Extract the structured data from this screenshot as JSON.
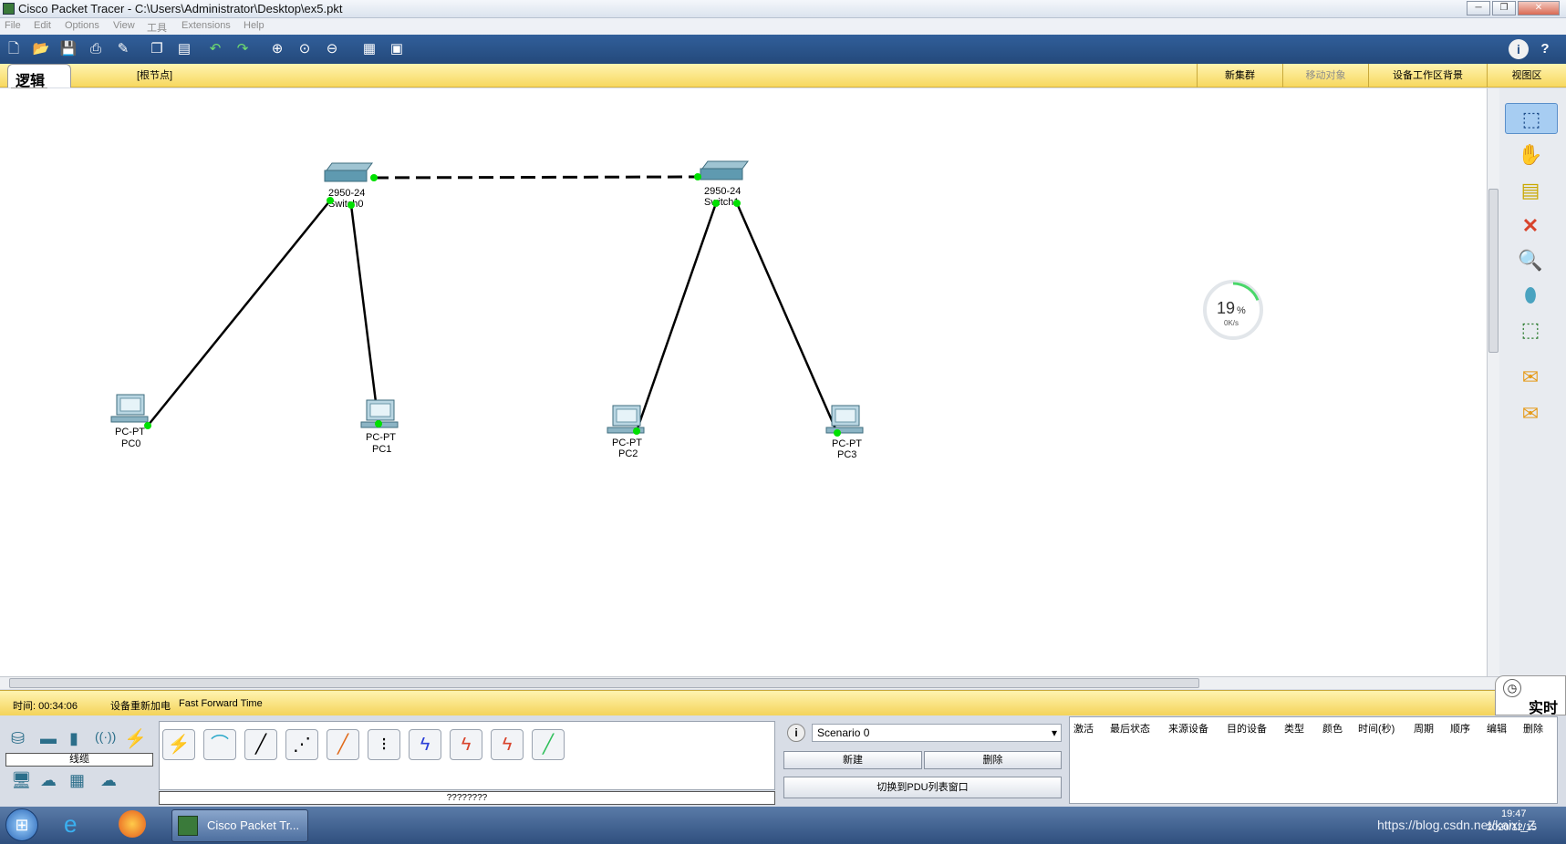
{
  "window": {
    "title": "Cisco Packet Tracer - C:\\Users\\Administrator\\Desktop\\ex5.pkt",
    "controls": [
      "minimize",
      "restore",
      "close"
    ]
  },
  "menu": [
    "File",
    "Edit",
    "Options",
    "View",
    "工具",
    "Extensions",
    "Help"
  ],
  "toolbar": {
    "left_icons": [
      "new-icon",
      "open-icon",
      "save-icon",
      "print-icon",
      "wizard-icon",
      "copy-icon",
      "paste-icon",
      "undo-icon",
      "redo-icon",
      "zoom-in-icon",
      "zoom-reset-icon",
      "zoom-out-icon",
      "palette-icon",
      "custom-device-icon"
    ],
    "right_icons": [
      "info-icon",
      "help-icon"
    ]
  },
  "logic_bar": {
    "tab_label": "逻辑",
    "root_label": "[根节点]",
    "new_cluster": "新集群",
    "move_object": "移动对象",
    "set_background": "设备工作区背景",
    "viewport": "视图区"
  },
  "devices": [
    {
      "model": "2950-24",
      "name": "Switch0"
    },
    {
      "model": "2950-24",
      "name": "Switch1"
    },
    {
      "model": "PC-PT",
      "name": "PC0"
    },
    {
      "model": "PC-PT",
      "name": "PC1"
    },
    {
      "model": "PC-PT",
      "name": "PC2"
    },
    {
      "model": "PC-PT",
      "name": "PC3"
    }
  ],
  "links": [
    {
      "from": "Switch0",
      "to": "Switch1",
      "style": "dashed"
    },
    {
      "from": "Switch0",
      "to": "PC0",
      "style": "solid"
    },
    {
      "from": "Switch0",
      "to": "PC1",
      "style": "solid"
    },
    {
      "from": "Switch1",
      "to": "PC2",
      "style": "solid"
    },
    {
      "from": "Switch1",
      "to": "PC3",
      "style": "solid"
    }
  ],
  "net_widget": {
    "percent": "19",
    "unit": "%",
    "speed": "0K/s",
    "level": 0.19
  },
  "right_tools": [
    "select-icon",
    "hand-icon",
    "note-icon",
    "delete-icon",
    "inspect-icon",
    "draw-shape-icon",
    "resize-icon",
    "add-simple-pdu-icon",
    "add-complex-pdu-icon"
  ],
  "status": {
    "time_label": "时间: 00:34:06",
    "power_cycle": "设备重新加电",
    "fast_forward": "Fast Forward Time",
    "mode": "实时"
  },
  "device_panel": {
    "category_label": "线缆",
    "bottom_label": "????????",
    "cables": [
      "auto-cable-icon",
      "console-cable-icon",
      "straight-cable-icon",
      "crossover-cable-icon",
      "fiber-cable-icon",
      "phone-cable-icon",
      "coaxial-cable-icon",
      "serial-dce-icon",
      "serial-dte-icon",
      "octal-cable-icon"
    ]
  },
  "scenario": {
    "selected": "Scenario 0",
    "new_button": "新建",
    "delete_button": "删除",
    "toggle_pdu": "切换到PDU列表窗口"
  },
  "pdu_columns": [
    "激活",
    "最后状态",
    "来源设备",
    "目的设备",
    "类型",
    "颜色",
    "时间(秒)",
    "周期",
    "顺序",
    "编辑",
    "删除"
  ],
  "taskbar": {
    "task_label": "Cisco Packet Tr...",
    "clock_time": "19:47",
    "clock_date": "2020/12/15",
    "watermark": "https://blog.csdn.net/kaixi_Z"
  },
  "colors": {
    "link_up": "#00e000",
    "toolbar_blue": "#2a5288",
    "logic_yellow": "#f7d860"
  }
}
